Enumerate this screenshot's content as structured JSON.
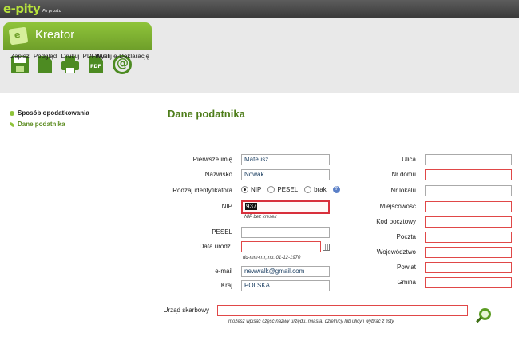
{
  "app": {
    "logo_text": "e-pity",
    "logo_tagline": "Po prostu"
  },
  "kreator": {
    "title": "Kreator"
  },
  "toolbar": {
    "save": "Zapisz",
    "preview": "Podgląd",
    "print": "Drukuj",
    "pdf": "PDF/Mail",
    "send": "Wyślij e-Deklarację",
    "pdf_icon_text": "PDF"
  },
  "sidebar": {
    "items": [
      {
        "label": "Sposób opodatkowania"
      },
      {
        "label": "Dane podatnika"
      }
    ]
  },
  "form": {
    "title": "Dane podatnika",
    "first_name": {
      "label": "Pierwsze imię",
      "value": "Mateusz"
    },
    "last_name": {
      "label": "Nazwisko",
      "value": "Nowak"
    },
    "id_type": {
      "label": "Rodzaj identyfikatora",
      "options": [
        "NIP",
        "PESEL",
        "brak"
      ],
      "selected": "NIP"
    },
    "nip": {
      "label": "NIP",
      "value": "937",
      "hint": "NIP bez kresek"
    },
    "pesel": {
      "label": "PESEL",
      "value": ""
    },
    "birth_date": {
      "label": "Data urodz.",
      "value": "",
      "hint": "dd-mm-rrrr, np. 01-12-1970"
    },
    "email": {
      "label": "e-mail",
      "value": "newwalk@gmail.com"
    },
    "country": {
      "label": "Kraj",
      "value": "POLSKA"
    },
    "street": {
      "label": "Ulica",
      "value": ""
    },
    "house_no": {
      "label": "Nr domu",
      "value": ""
    },
    "flat_no": {
      "label": "Nr lokalu",
      "value": ""
    },
    "city": {
      "label": "Miejscowość",
      "value": ""
    },
    "postal_code": {
      "label": "Kod pocztowy",
      "value": ""
    },
    "post_office": {
      "label": "Poczta",
      "value": ""
    },
    "voivodeship": {
      "label": "Województwo",
      "value": ""
    },
    "county": {
      "label": "Powiat",
      "value": ""
    },
    "commune": {
      "label": "Gmina",
      "value": ""
    },
    "tax_office": {
      "label": "Urząd skarbowy",
      "value": "",
      "hint": "możesz wpisać część nazwy urzędu, miasta, dzielnicy lub ulicy i wybrać z listy"
    }
  },
  "colors": {
    "accent": "#8fc43a",
    "title": "#4e7d1a",
    "required_border": "#e04848"
  }
}
